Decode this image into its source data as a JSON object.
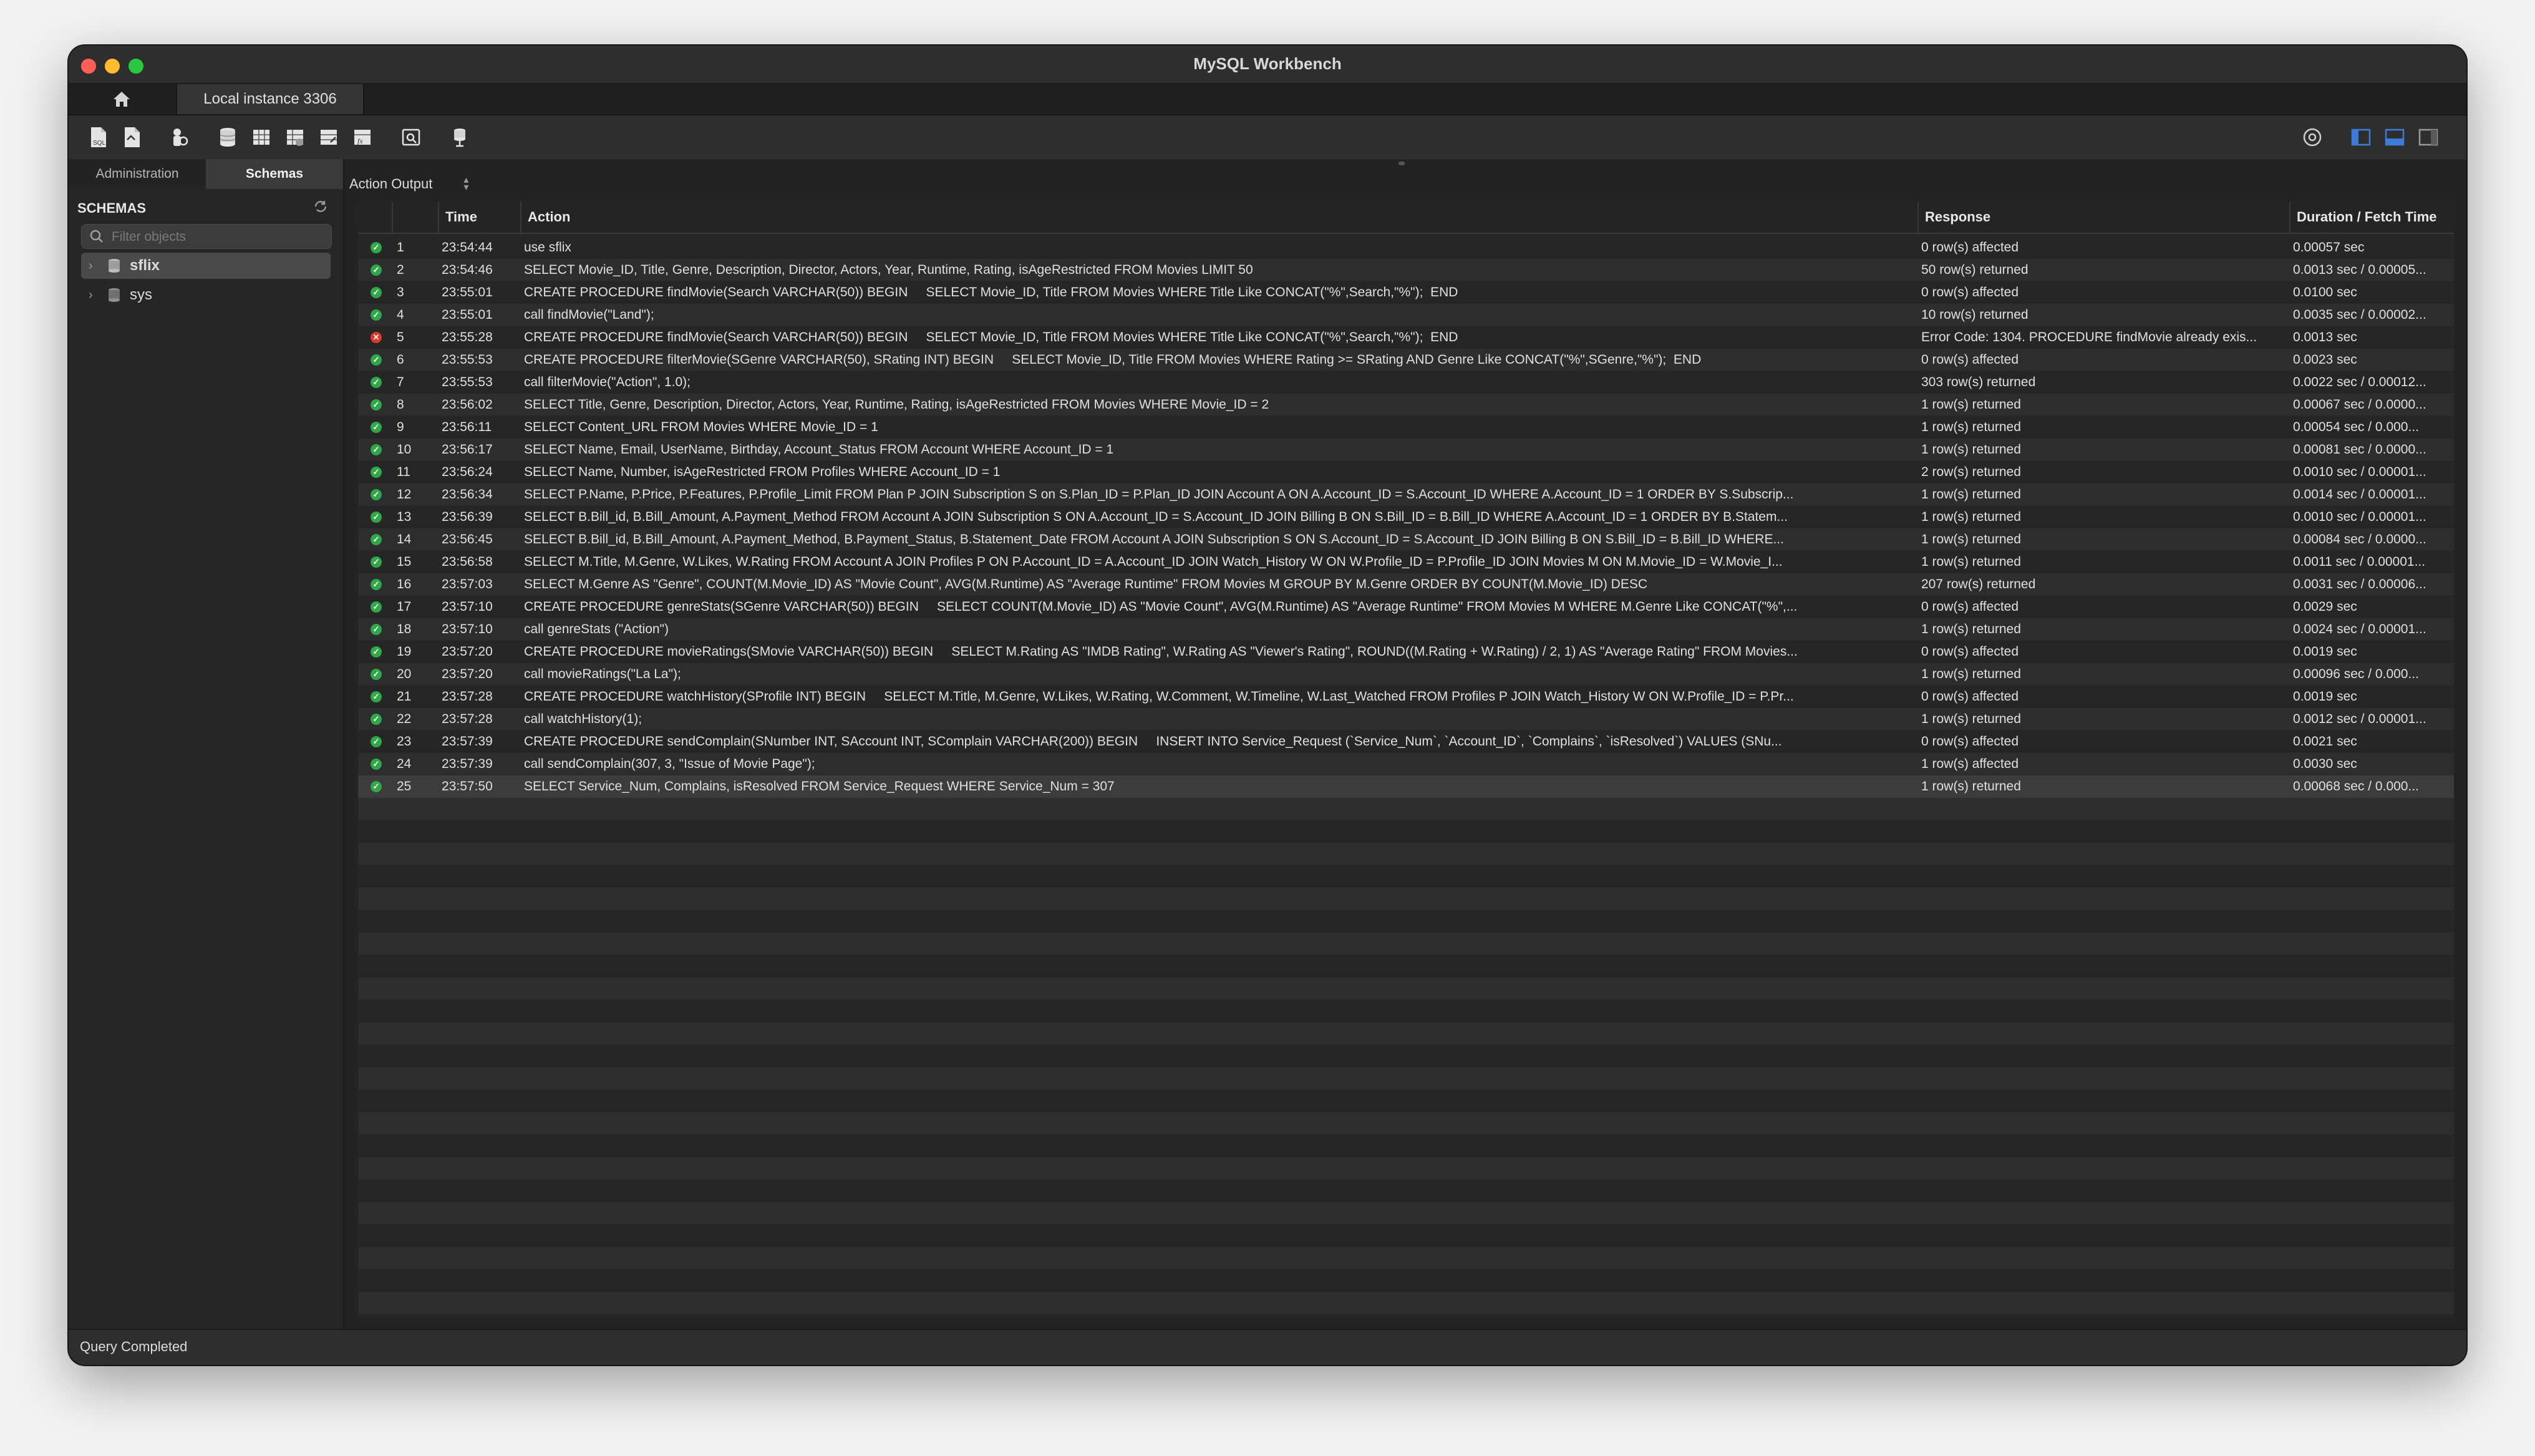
{
  "window": {
    "title": "MySQL Workbench"
  },
  "tabs": {
    "home_icon": "home-icon",
    "connection": "Local instance 3306"
  },
  "toolbar": {
    "icons": [
      "new-sql-file-icon",
      "open-sql-file-icon",
      "inspector-icon",
      "create-schema-icon",
      "create-table-icon",
      "create-view-icon",
      "create-procedure-icon",
      "create-function-icon",
      "search-table-icon",
      "reconnect-icon"
    ],
    "right_icons": [
      "settings-icon",
      "toggle-sidebar-icon",
      "toggle-output-icon",
      "toggle-secondary-sidebar-icon"
    ],
    "accent": "#3d7bd9"
  },
  "sidebar": {
    "tabs": [
      "Administration",
      "Schemas"
    ],
    "active_tab": "Schemas",
    "heading": "SCHEMAS",
    "filter_placeholder": "Filter objects",
    "schemas": [
      "sflix",
      "sys"
    ]
  },
  "output": {
    "selector": "Action Output",
    "columns": [
      "Time",
      "Action",
      "Response",
      "Duration / Fetch Time"
    ],
    "rows": [
      {
        "status": "ok",
        "n": "1",
        "time": "23:54:44",
        "action": "use sflix",
        "response": "0 row(s) affected",
        "duration": "0.00057 sec"
      },
      {
        "status": "ok",
        "n": "2",
        "time": "23:54:46",
        "action": "SELECT Movie_ID, Title, Genre, Description, Director, Actors, Year, Runtime, Rating, isAgeRestricted FROM Movies LIMIT 50",
        "response": "50 row(s) returned",
        "duration": "0.0013 sec / 0.00005..."
      },
      {
        "status": "ok",
        "n": "3",
        "time": "23:55:01",
        "action": "CREATE PROCEDURE findMovie(Search VARCHAR(50)) BEGIN     SELECT Movie_ID, Title FROM Movies WHERE Title Like CONCAT(\"%\",Search,\"%\");  END",
        "response": "0 row(s) affected",
        "duration": "0.0100 sec"
      },
      {
        "status": "ok",
        "n": "4",
        "time": "23:55:01",
        "action": "call findMovie(\"Land\");",
        "response": "10 row(s) returned",
        "duration": "0.0035 sec / 0.00002..."
      },
      {
        "status": "err",
        "n": "5",
        "time": "23:55:28",
        "action": "CREATE PROCEDURE findMovie(Search VARCHAR(50)) BEGIN     SELECT Movie_ID, Title FROM Movies WHERE Title Like CONCAT(\"%\",Search,\"%\");  END",
        "response": "Error Code: 1304. PROCEDURE findMovie already exis...",
        "duration": "0.0013 sec"
      },
      {
        "status": "ok",
        "n": "6",
        "time": "23:55:53",
        "action": "CREATE PROCEDURE filterMovie(SGenre VARCHAR(50), SRating INT) BEGIN     SELECT Movie_ID, Title FROM Movies WHERE Rating >= SRating AND Genre Like CONCAT(\"%\",SGenre,\"%\");  END",
        "response": "0 row(s) affected",
        "duration": "0.0023 sec"
      },
      {
        "status": "ok",
        "n": "7",
        "time": "23:55:53",
        "action": "call filterMovie(\"Action\", 1.0);",
        "response": "303 row(s) returned",
        "duration": "0.0022 sec / 0.00012..."
      },
      {
        "status": "ok",
        "n": "8",
        "time": "23:56:02",
        "action": "SELECT Title, Genre, Description, Director, Actors, Year, Runtime, Rating, isAgeRestricted FROM Movies WHERE Movie_ID = 2",
        "response": "1 row(s) returned",
        "duration": "0.00067 sec / 0.0000..."
      },
      {
        "status": "ok",
        "n": "9",
        "time": "23:56:11",
        "action": "SELECT Content_URL FROM Movies WHERE Movie_ID = 1",
        "response": "1 row(s) returned",
        "duration": "0.00054 sec / 0.000..."
      },
      {
        "status": "ok",
        "n": "10",
        "time": "23:56:17",
        "action": "SELECT Name, Email, UserName, Birthday, Account_Status FROM Account WHERE Account_ID = 1",
        "response": "1 row(s) returned",
        "duration": "0.00081 sec / 0.0000..."
      },
      {
        "status": "ok",
        "n": "11",
        "time": "23:56:24",
        "action": "SELECT Name, Number, isAgeRestricted FROM Profiles WHERE Account_ID = 1",
        "response": "2 row(s) returned",
        "duration": "0.0010 sec / 0.00001..."
      },
      {
        "status": "ok",
        "n": "12",
        "time": "23:56:34",
        "action": "SELECT P.Name, P.Price, P.Features, P.Profile_Limit FROM Plan P JOIN Subscription S on S.Plan_ID = P.Plan_ID JOIN Account A ON A.Account_ID = S.Account_ID WHERE A.Account_ID = 1 ORDER BY S.Subscrip...",
        "response": "1 row(s) returned",
        "duration": "0.0014 sec / 0.00001..."
      },
      {
        "status": "ok",
        "n": "13",
        "time": "23:56:39",
        "action": "SELECT B.Bill_id, B.Bill_Amount, A.Payment_Method FROM Account A JOIN Subscription S ON A.Account_ID = S.Account_ID JOIN Billing B ON S.Bill_ID = B.Bill_ID WHERE A.Account_ID = 1 ORDER BY B.Statem...",
        "response": "1 row(s) returned",
        "duration": "0.0010 sec / 0.00001..."
      },
      {
        "status": "ok",
        "n": "14",
        "time": "23:56:45",
        "action": "SELECT B.Bill_id, B.Bill_Amount, A.Payment_Method, B.Payment_Status, B.Statement_Date FROM Account A JOIN Subscription S ON S.Account_ID = S.Account_ID JOIN Billing B ON S.Bill_ID = B.Bill_ID WHERE...",
        "response": "1 row(s) returned",
        "duration": "0.00084 sec / 0.0000..."
      },
      {
        "status": "ok",
        "n": "15",
        "time": "23:56:58",
        "action": "SELECT M.Title, M.Genre, W.Likes, W.Rating FROM Account A JOIN Profiles P ON P.Account_ID = A.Account_ID JOIN Watch_History W ON W.Profile_ID = P.Profile_ID JOIN Movies M ON M.Movie_ID = W.Movie_I...",
        "response": "1 row(s) returned",
        "duration": "0.0011 sec / 0.00001..."
      },
      {
        "status": "ok",
        "n": "16",
        "time": "23:57:03",
        "action": "SELECT M.Genre AS \"Genre\", COUNT(M.Movie_ID) AS \"Movie Count\", AVG(M.Runtime) AS \"Average Runtime\" FROM Movies M GROUP BY M.Genre ORDER BY COUNT(M.Movie_ID) DESC",
        "response": "207 row(s) returned",
        "duration": "0.0031 sec / 0.00006..."
      },
      {
        "status": "ok",
        "n": "17",
        "time": "23:57:10",
        "action": "CREATE PROCEDURE genreStats(SGenre VARCHAR(50)) BEGIN     SELECT COUNT(M.Movie_ID) AS \"Movie Count\", AVG(M.Runtime) AS \"Average Runtime\" FROM Movies M WHERE M.Genre Like CONCAT(\"%\",...",
        "response": "0 row(s) affected",
        "duration": "0.0029 sec"
      },
      {
        "status": "ok",
        "n": "18",
        "time": "23:57:10",
        "action": "call genreStats (\"Action\")",
        "response": "1 row(s) returned",
        "duration": "0.0024 sec / 0.00001..."
      },
      {
        "status": "ok",
        "n": "19",
        "time": "23:57:20",
        "action": "CREATE PROCEDURE movieRatings(SMovie VARCHAR(50)) BEGIN     SELECT M.Rating AS \"IMDB Rating\", W.Rating AS \"Viewer's Rating\", ROUND((M.Rating + W.Rating) / 2, 1) AS \"Average Rating\" FROM Movies...",
        "response": "0 row(s) affected",
        "duration": "0.0019 sec"
      },
      {
        "status": "ok",
        "n": "20",
        "time": "23:57:20",
        "action": "call movieRatings(\"La La\");",
        "response": "1 row(s) returned",
        "duration": "0.00096 sec / 0.000..."
      },
      {
        "status": "ok",
        "n": "21",
        "time": "23:57:28",
        "action": "CREATE PROCEDURE watchHistory(SProfile INT) BEGIN     SELECT M.Title, M.Genre, W.Likes, W.Rating, W.Comment, W.Timeline, W.Last_Watched FROM Profiles P JOIN Watch_History W ON W.Profile_ID = P.Pr...",
        "response": "0 row(s) affected",
        "duration": "0.0019 sec"
      },
      {
        "status": "ok",
        "n": "22",
        "time": "23:57:28",
        "action": "call watchHistory(1);",
        "response": "1 row(s) returned",
        "duration": "0.0012 sec / 0.00001..."
      },
      {
        "status": "ok",
        "n": "23",
        "time": "23:57:39",
        "action": "CREATE PROCEDURE sendComplain(SNumber INT, SAccount INT, SComplain VARCHAR(200)) BEGIN     INSERT INTO Service_Request (`Service_Num`, `Account_ID`, `Complains`, `isResolved`) VALUES (SNu...",
        "response": "0 row(s) affected",
        "duration": "0.0021 sec"
      },
      {
        "status": "ok",
        "n": "24",
        "time": "23:57:39",
        "action": "call sendComplain(307, 3, \"Issue of Movie Page\");",
        "response": "1 row(s) affected",
        "duration": "0.0030 sec"
      },
      {
        "status": "ok",
        "n": "25",
        "time": "23:57:50",
        "action": "SELECT Service_Num, Complains, isResolved FROM Service_Request WHERE Service_Num = 307",
        "response": "1 row(s) returned",
        "duration": "0.00068 sec / 0.000..."
      }
    ]
  },
  "statusbar": {
    "text": "Query Completed"
  }
}
